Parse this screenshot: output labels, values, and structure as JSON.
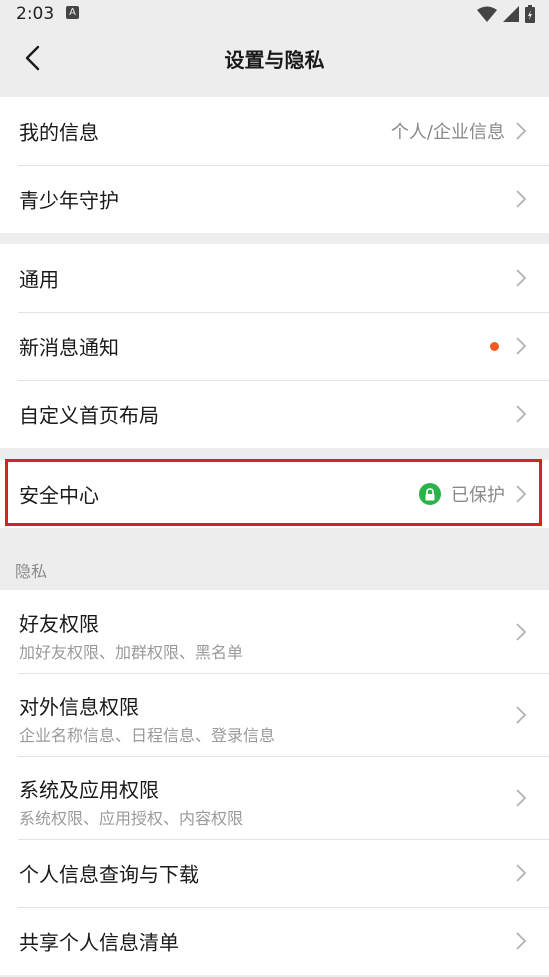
{
  "status": {
    "time": "2:03",
    "a_badge": "A"
  },
  "nav": {
    "title": "设置与隐私"
  },
  "group1": [
    {
      "title": "我的信息",
      "value": "个人/企业信息"
    },
    {
      "title": "青少年守护"
    }
  ],
  "group2": [
    {
      "title": "通用"
    },
    {
      "title": "新消息通知"
    },
    {
      "title": "自定义首页布局"
    }
  ],
  "security": {
    "title": "安全中心",
    "value": "已保护"
  },
  "privacy_section": {
    "label": "隐私"
  },
  "privacy": [
    {
      "title": "好友权限",
      "sub": "加好友权限、加群权限、黑名单"
    },
    {
      "title": "对外信息权限",
      "sub": "企业名称信息、日程信息、登录信息"
    },
    {
      "title": "系统及应用权限",
      "sub": "系统权限、应用授权、内容权限"
    },
    {
      "title": "个人信息查询与下载"
    },
    {
      "title": "共享个人信息清单"
    }
  ],
  "colors": {
    "accent_dot": "#f05a23",
    "lock_green": "#2bb34a",
    "highlight": "#e01e1e",
    "background": "#ededed"
  }
}
